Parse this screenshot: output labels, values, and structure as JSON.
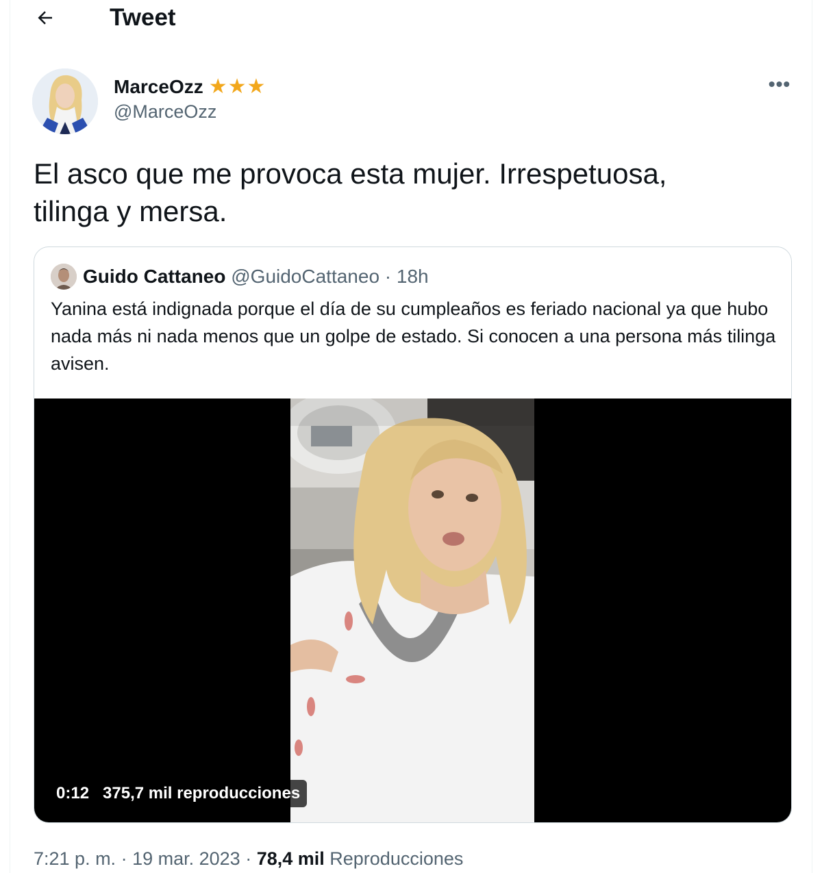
{
  "header": {
    "title": "Tweet"
  },
  "tweet": {
    "author_name": "MarceOzz",
    "author_handle": "@MarceOzz",
    "badge_stars": "★★★",
    "more": "•••",
    "text_line1": "El asco que me provoca esta mujer. Irrespetuosa,",
    "text_line2": "tilinga y mersa.",
    "time": "7:21 p. m.",
    "sep1": " · ",
    "date": "19 mar. 2023",
    "sep2": " · ",
    "views_count": "78,4 mil",
    "views_label": " Reproducciones"
  },
  "quote": {
    "author_name": "Guido Cattaneo",
    "author_handle": "@GuidoCattaneo",
    "sep": " · ",
    "time": "18h",
    "text": "Yanina está indignada porque el día de su cumpleaños es feriado nacional ya que hubo nada más ni nada menos que un golpe de estado. Si conocen a una persona más tilinga avisen.",
    "video": {
      "duration": "0:12",
      "views": "375,7 mil reproducciones"
    }
  },
  "colors": {
    "text_primary": "#0f1419",
    "text_secondary": "#536471",
    "border": "#cfd9de",
    "star": "#f2a71b",
    "video_bg": "#000000"
  },
  "icons": {
    "back": "back-arrow-icon",
    "more": "more-options-icon",
    "star": "star-icon"
  }
}
